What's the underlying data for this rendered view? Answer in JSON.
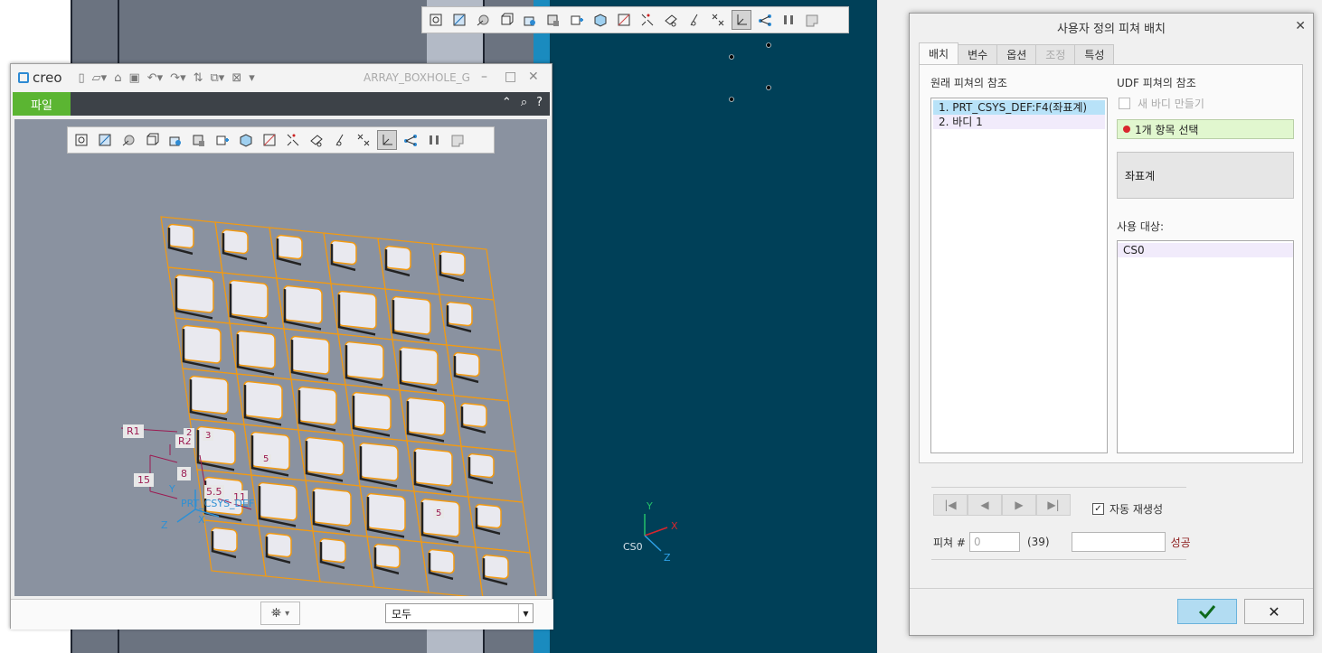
{
  "workspace": {
    "colors": {
      "viewport_bg": "#004058",
      "gray": "#6b7380",
      "accent_blue": "#1a8bbf"
    },
    "csys": {
      "label": "CS0",
      "x": "X",
      "y": "Y",
      "z": "Z"
    }
  },
  "toolbar_icons": [
    "zoom-icon",
    "refit-icon",
    "shading-icon",
    "display-style-icon",
    "saved-views-icon",
    "view-manager-icon",
    "perspective-icon",
    "orient-icon",
    "datum-display-icon",
    "plane-icon",
    "axis-icon",
    "point-icon",
    "csys-display-icon",
    "spin-center-icon",
    "annotation-icon",
    "pause-icon",
    "appearance-icon"
  ],
  "creo": {
    "logo": "creo",
    "title": "ARRAY_BOXHOLE_G",
    "file_tab": "파일",
    "filter_value": "모두",
    "dims": {
      "r1": "R1",
      "r2": "R2",
      "d15": "15",
      "d8": "8",
      "d55": "5.5",
      "d11": "11",
      "d5a": "5",
      "d5b": "5",
      "d3": "3",
      "d2": "2",
      "csys_label": "PRT_CSYS_DEF",
      "x": "X",
      "y": "Y",
      "z": "Z"
    }
  },
  "dialog": {
    "title": "사용자 정의 피쳐 배치",
    "tabs": [
      {
        "label": "배치",
        "state": "active"
      },
      {
        "label": "변수",
        "state": "normal"
      },
      {
        "label": "옵션",
        "state": "normal"
      },
      {
        "label": "조정",
        "state": "disabled"
      },
      {
        "label": "특성",
        "state": "normal"
      }
    ],
    "original_refs_label": "원래 피쳐의 참조",
    "original_refs": [
      "1. PRT_CSYS_DEF:F4(좌표계)",
      "2. 바디 1"
    ],
    "udf_refs_label": "UDF 피쳐의 참조",
    "new_body_label": "새 바디 만들기",
    "selection_text": "1개 항목 선택",
    "csys_button_label": "좌표계",
    "used_for_label": "사용 대상:",
    "used_for_items": [
      "CS0"
    ],
    "auto_regen_label": "자동 재생성",
    "feature_label": "피쳐 #",
    "feature_placeholder": "0",
    "feature_count": "(39)",
    "success_label": "성공",
    "colors": {
      "selection_bg": "#e1f7cf",
      "selected_row": "#b8e2f8",
      "ok_bg": "#b2dcf2",
      "success": "#8b1a1a"
    }
  }
}
